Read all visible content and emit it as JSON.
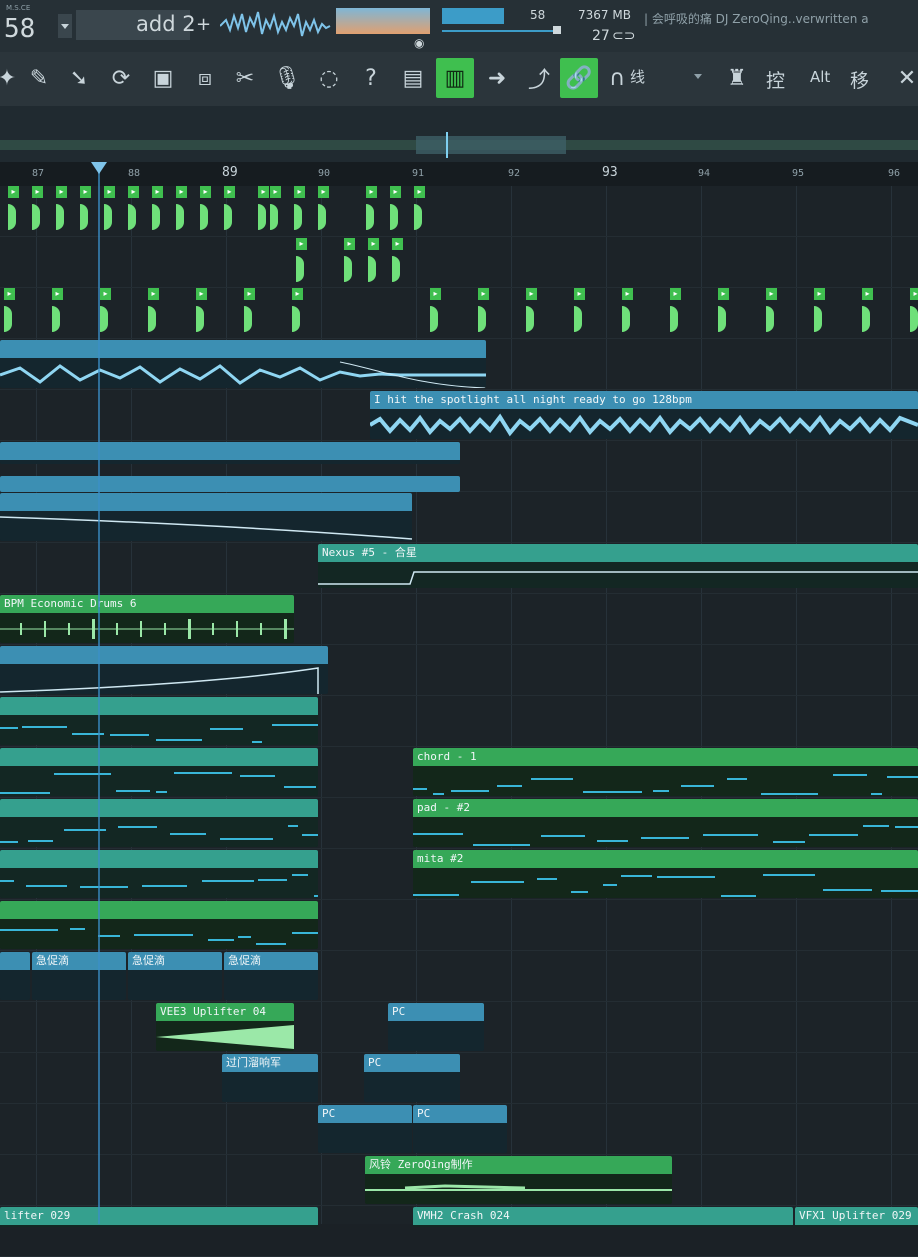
{
  "info": {
    "tempo_small": "M.S.CE",
    "tempo": "58",
    "pattern": "add 2",
    "plus": "+",
    "cpu": "58",
    "memory": "7367 MB",
    "polyphony": "27",
    "title": "| 会呼吸的痛 DJ ZeroQing..verwritten a"
  },
  "toolbar": {
    "snap_label": "线",
    "ctrl_label": "控",
    "alt_label": "Alt",
    "move_label": "移"
  },
  "ruler": {
    "ticks": [
      "87",
      "88",
      "89",
      "90",
      "91",
      "92",
      "93",
      "94",
      "95",
      "96"
    ]
  },
  "clips": {
    "spotlight": "I hit the spotlight all night ready to go  128bpm",
    "nexus": "Nexus #5 - 合星",
    "drums": "BPM Economic Drums 6",
    "chord": "chord - 1",
    "pad": "pad - #2",
    "mita": "mita #2",
    "cuxiao1": "急促滴",
    "cuxiao2": "急促滴",
    "cuxiao3": "急促滴",
    "uplifter": "VEE3 Uplifter 04",
    "pc1": "PC",
    "guomen": "过门溜响军",
    "pc2": "PC",
    "pc3": "PC",
    "pc4": "PC",
    "fengling": "风铃 ZeroQing制作",
    "uplifter029": "lifter 029",
    "crash": "VMH2 Crash 024",
    "vfx": "VFX1 Uplifter 029"
  },
  "colors": {
    "accent_green": "#3fbf4f",
    "clip_blue": "#3c8fb3",
    "clip_green": "#36a858",
    "note_cyan": "#39b6d8"
  }
}
